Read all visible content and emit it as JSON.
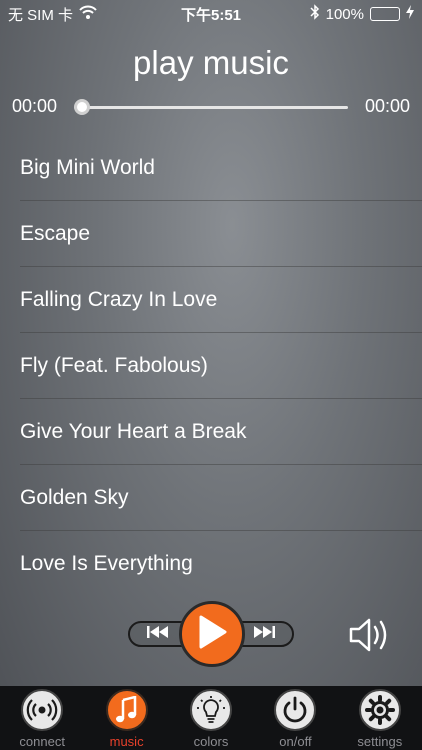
{
  "status_bar": {
    "carrier": "无 SIM 卡",
    "time": "下午5:51",
    "battery_percent": "100%",
    "battery_level": 1.0,
    "icons": [
      "wifi-icon",
      "bluetooth-icon",
      "battery-icon",
      "charging-icon"
    ]
  },
  "header": {
    "title": "play music"
  },
  "progress": {
    "elapsed": "00:00",
    "total": "00:00",
    "fraction": 0.0
  },
  "songs": [
    {
      "title": "Big Mini World"
    },
    {
      "title": "Escape"
    },
    {
      "title": "Falling Crazy In Love"
    },
    {
      "title": "Fly (Feat. Fabolous)"
    },
    {
      "title": "Give Your Heart a Break"
    },
    {
      "title": "Golden Sky"
    },
    {
      "title": "Love Is Everything"
    }
  ],
  "controls": {
    "icons": [
      "previous-icon",
      "play-icon",
      "next-icon",
      "volume-icon"
    ],
    "accent_color": "#f26b1d"
  },
  "tabs": [
    {
      "label": "connect",
      "icon": "broadcast-icon",
      "active": false
    },
    {
      "label": "music",
      "icon": "music-note-icon",
      "active": true
    },
    {
      "label": "colors",
      "icon": "lightbulb-icon",
      "active": false
    },
    {
      "label": "on/off",
      "icon": "power-icon",
      "active": false
    },
    {
      "label": "settings",
      "icon": "gear-icon",
      "active": false
    }
  ],
  "colors": {
    "active_tab_label": "#e8412b",
    "inactive_tab_label": "#8e8e93"
  }
}
